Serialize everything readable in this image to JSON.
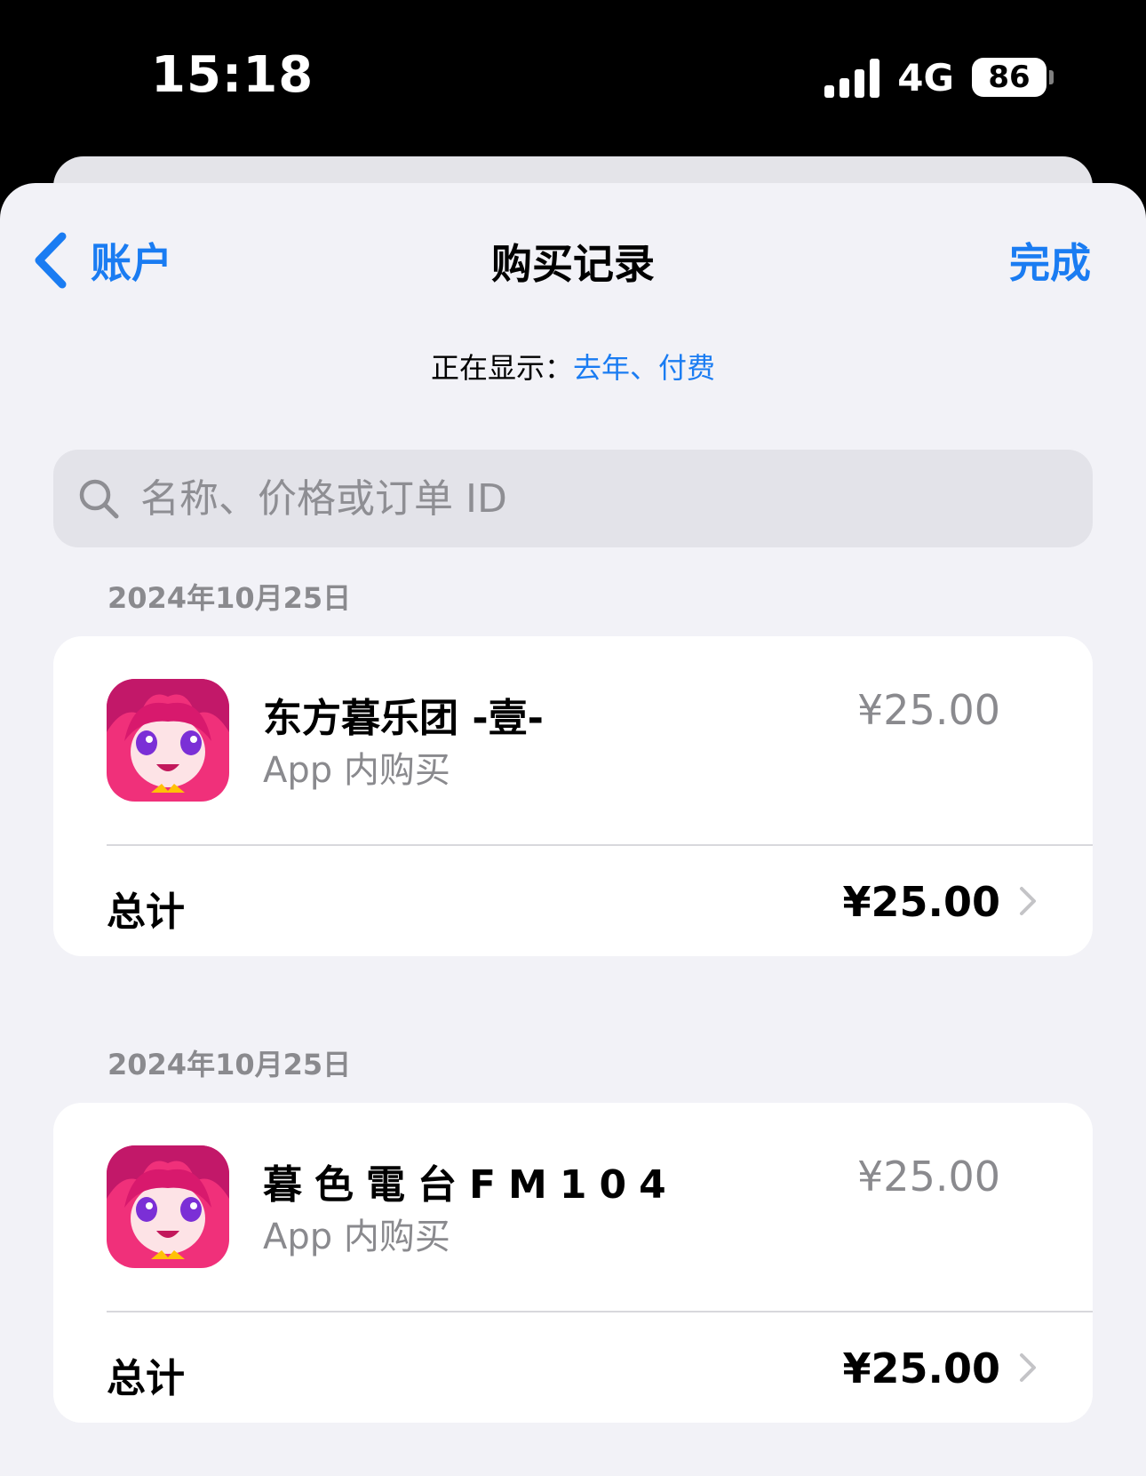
{
  "status_bar": {
    "time": "15:18",
    "network": "4G",
    "battery": "86"
  },
  "nav": {
    "back_label": "账户",
    "title": "购买记录",
    "done_label": "完成"
  },
  "filter": {
    "prefix": "正在显示：",
    "value": "去年、付费"
  },
  "search": {
    "placeholder": "名称、价格或订单 ID",
    "value": ""
  },
  "purchases": [
    {
      "date": "2024年10月25日",
      "item_name": "东方暮乐团 -壹-",
      "item_type": "App 内购买",
      "item_price": "¥25.00",
      "total_label": "总计",
      "total_amount": "¥25.00",
      "icon": "anime-girl-app-icon"
    },
    {
      "date": "2024年10月25日",
      "item_name": "暮色電台FM104",
      "item_type": "App 内购买",
      "item_price": "¥25.00",
      "total_label": "总计",
      "total_amount": "¥25.00",
      "icon": "anime-girl-app-icon"
    }
  ],
  "colors": {
    "accent": "#1a7cf2",
    "sheet_background": "#f2f2f7",
    "secondary_text": "#8a8a8e",
    "icon_pink": "#f0307a"
  }
}
